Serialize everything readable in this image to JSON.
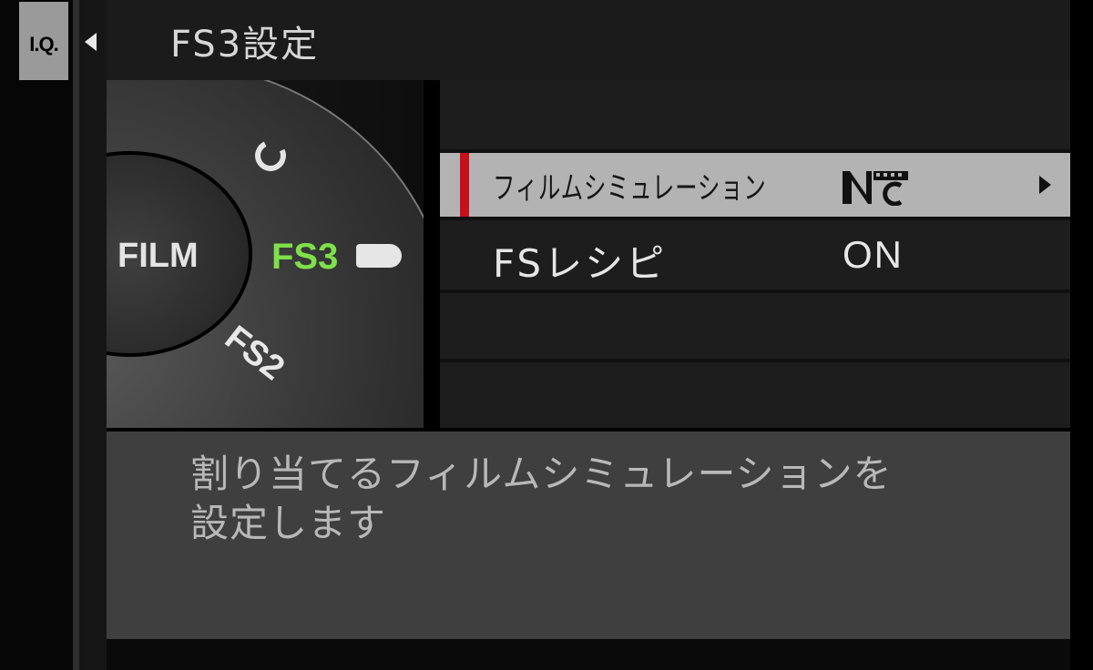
{
  "sidebar": {
    "iq_tab": "I.Q."
  },
  "header": {
    "title": "FS3設定"
  },
  "dial": {
    "positions": [
      "FILM",
      "FS3",
      "FS2"
    ],
    "selected": "FS3",
    "icon": "custom-c-icon",
    "selected_color": "#7ee04a"
  },
  "menu": {
    "items": [
      {
        "label": "フィルムシミュレーション",
        "value_icon": "classic-neg-film-icon",
        "selected": true
      },
      {
        "label": "FSレシピ",
        "value": "ON",
        "selected": false
      }
    ],
    "accent_color": "#c8101a"
  },
  "description": {
    "line1": "割り当てるフィルムシミュレーションを",
    "line2": "設定します"
  }
}
